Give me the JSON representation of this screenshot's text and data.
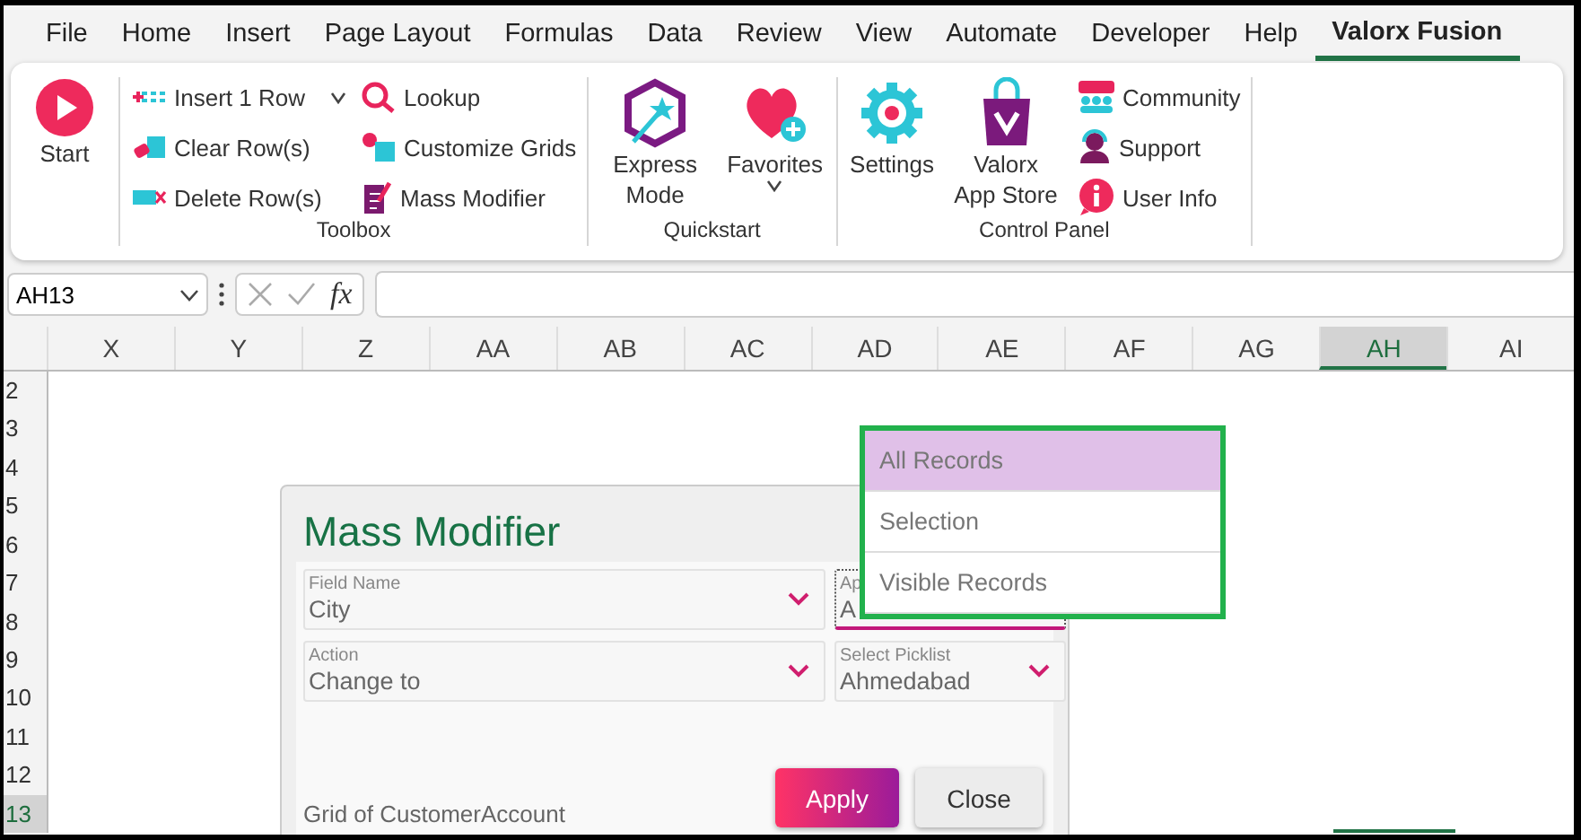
{
  "menu_tabs": [
    {
      "label": "File",
      "selected": false
    },
    {
      "label": "Home",
      "selected": false
    },
    {
      "label": "Insert",
      "selected": false
    },
    {
      "label": "Page Layout",
      "selected": false
    },
    {
      "label": "Formulas",
      "selected": false
    },
    {
      "label": "Data",
      "selected": false
    },
    {
      "label": "Review",
      "selected": false
    },
    {
      "label": "View",
      "selected": false
    },
    {
      "label": "Automate",
      "selected": false
    },
    {
      "label": "Developer",
      "selected": false
    },
    {
      "label": "Help",
      "selected": false
    },
    {
      "label": "Valorx Fusion",
      "selected": true
    }
  ],
  "ribbon": {
    "groups": [
      {
        "columns": [
          [
            {
              "kind": "large",
              "label": "Start",
              "dropdown": false
            }
          ]
        ]
      },
      {
        "label": "Toolbox",
        "columns": [
          [
            {
              "kind": "small",
              "label": "Insert 1 Row",
              "dropdown": true
            },
            {
              "kind": "small",
              "label": "Clear Row(s)",
              "dropdown": false
            },
            {
              "kind": "small",
              "label": "Delete Row(s)",
              "dropdown": false
            }
          ],
          [
            {
              "kind": "small",
              "label": "Lookup",
              "dropdown": false
            },
            {
              "kind": "small",
              "label": "Customize Grids",
              "dropdown": false
            },
            {
              "kind": "small",
              "label": "Mass Modifier",
              "dropdown": false
            }
          ]
        ]
      },
      {
        "label": "Quickstart",
        "columns": [
          [
            {
              "kind": "large",
              "label": "Express Mode",
              "dropdown": false
            }
          ],
          [
            {
              "kind": "large",
              "label": "Favorites",
              "dropdown": true
            }
          ]
        ]
      },
      {
        "label": "Control Panel",
        "columns": [
          [
            {
              "kind": "large",
              "label": "Settings",
              "dropdown": false
            }
          ],
          [
            {
              "kind": "large",
              "label": "Valorx App Store",
              "dropdown": false
            }
          ],
          [
            {
              "kind": "small",
              "label": "Community",
              "dropdown": false
            },
            {
              "kind": "small",
              "label": "Support",
              "dropdown": false
            },
            {
              "kind": "small",
              "label": "User Info",
              "dropdown": false
            }
          ]
        ]
      }
    ]
  },
  "name_box": {
    "value": "AH13"
  },
  "formula_bar": {
    "fx": "fx"
  },
  "columns": [
    {
      "label": "X",
      "selected": false
    },
    {
      "label": "Y",
      "selected": false
    },
    {
      "label": "Z",
      "selected": false
    },
    {
      "label": "AA",
      "selected": false
    },
    {
      "label": "AB",
      "selected": false
    },
    {
      "label": "AC",
      "selected": false
    },
    {
      "label": "AD",
      "selected": false
    },
    {
      "label": "AE",
      "selected": false
    },
    {
      "label": "AF",
      "selected": false
    },
    {
      "label": "AG",
      "selected": false
    },
    {
      "label": "AH",
      "selected": true
    },
    {
      "label": "AI",
      "selected": false
    }
  ],
  "rows": [
    {
      "label": "2",
      "selected": false
    },
    {
      "label": "3",
      "selected": false
    },
    {
      "label": "4",
      "selected": false
    },
    {
      "label": "5",
      "selected": false
    },
    {
      "label": "6",
      "selected": false
    },
    {
      "label": "7",
      "selected": false
    },
    {
      "label": "8",
      "selected": false
    },
    {
      "label": "9",
      "selected": false
    },
    {
      "label": "10",
      "selected": false
    },
    {
      "label": "11",
      "selected": false
    },
    {
      "label": "12",
      "selected": false
    },
    {
      "label": "13",
      "selected": true
    }
  ],
  "dialog": {
    "title": "Mass Modifier",
    "fields": [
      {
        "label": "Field Name",
        "value": "City",
        "focused": false
      },
      {
        "label": "Ap",
        "value": "A",
        "focused": true
      },
      {
        "label": "Action",
        "value": "Change to",
        "focused": false
      },
      {
        "label": "Select Picklist",
        "value": "Ahmedabad",
        "focused": false
      }
    ],
    "footer": "Grid of CustomerAccount",
    "buttons": [
      {
        "label": "Apply",
        "kind": "primary"
      },
      {
        "label": "Close",
        "kind": "secondary"
      }
    ]
  },
  "dropdown": {
    "items": [
      {
        "label": "All Records",
        "selected": true
      },
      {
        "label": "Selection",
        "selected": false
      },
      {
        "label": "Visible Records",
        "selected": false
      }
    ]
  }
}
